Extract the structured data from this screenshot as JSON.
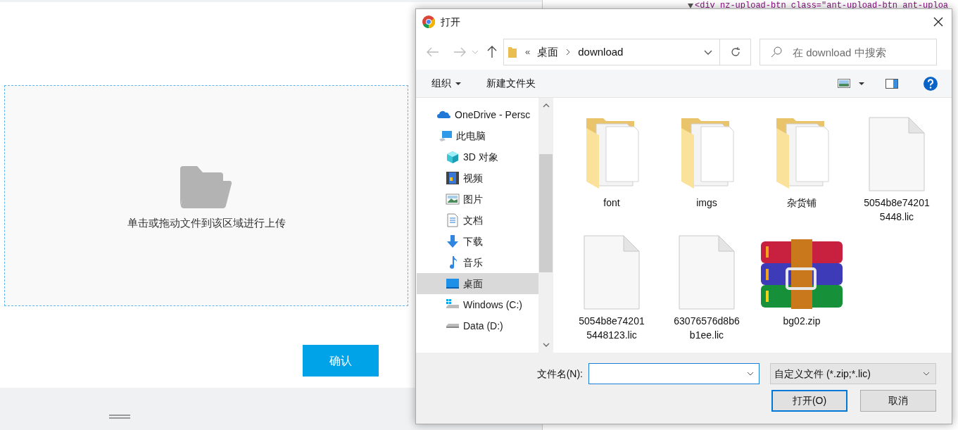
{
  "page": {
    "dropzone_text": "单击或拖动文件到该区域进行上传",
    "confirm_button": "确认"
  },
  "devtools": {
    "code_line": "<div nz-upload-btn class=\"ant-upload-btn ant-uploa"
  },
  "dialog": {
    "title": "打开",
    "path_prefix": "«",
    "path": [
      "桌面",
      "download"
    ],
    "search": {
      "placeholder": "在 download 中搜索"
    },
    "toolbar": {
      "organize": "组织",
      "new_folder": "新建文件夹"
    },
    "nav": [
      {
        "label": "OneDrive - Persc",
        "kind": "cloud",
        "selected": false
      },
      {
        "label": "此电脑",
        "kind": "computer",
        "selected": false,
        "children": [
          {
            "label": "3D 对象",
            "kind": "cube",
            "selected": false
          },
          {
            "label": "视频",
            "kind": "video",
            "selected": false
          },
          {
            "label": "图片",
            "kind": "picture",
            "selected": false
          },
          {
            "label": "文档",
            "kind": "document",
            "selected": false
          },
          {
            "label": "下载",
            "kind": "download",
            "selected": false
          },
          {
            "label": "音乐",
            "kind": "music",
            "selected": false
          },
          {
            "label": "桌面",
            "kind": "desktop",
            "selected": true
          },
          {
            "label": "Windows (C:)",
            "kind": "system-drive",
            "selected": false
          },
          {
            "label": "Data (D:)",
            "kind": "drive",
            "selected": false
          }
        ]
      }
    ],
    "files": [
      {
        "name": "font",
        "kind": "folder"
      },
      {
        "name": "imgs",
        "kind": "folder"
      },
      {
        "name": "杂货铺",
        "kind": "folder"
      },
      {
        "name": "5054b8e742015448.lic",
        "kind": "file"
      },
      {
        "name": "5054b8e742015448123.lic",
        "kind": "file"
      },
      {
        "name": "63076576d8b6b1ee.lic",
        "kind": "file"
      },
      {
        "name": "bg02.zip",
        "kind": "archive"
      }
    ],
    "filename_label": "文件名(N):",
    "file_type": "自定义文件 (*.zip;*.lic)",
    "buttons": [
      {
        "label": "打开(O)",
        "primary": true
      },
      {
        "label": "取消",
        "primary": false
      }
    ]
  }
}
